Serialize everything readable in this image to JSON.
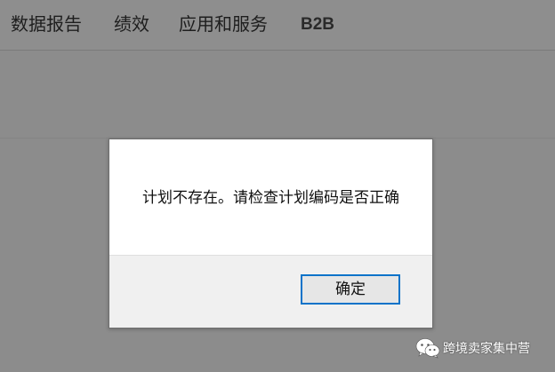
{
  "nav": {
    "items": [
      {
        "label": "数据报告"
      },
      {
        "label": "绩效"
      },
      {
        "label": "应用和服务"
      },
      {
        "label": "B2B"
      }
    ]
  },
  "dialog": {
    "message": "计划不存在。请检查计划编码是否正确",
    "ok_label": "确定"
  },
  "watermark": {
    "icon": "wechat-icon",
    "text": "跨境卖家集中营"
  },
  "colors": {
    "overlay": "#8c8c8c",
    "dialog_bg": "#ffffff",
    "footer_bg": "#f0f0f0",
    "button_border": "#0a73c9"
  }
}
